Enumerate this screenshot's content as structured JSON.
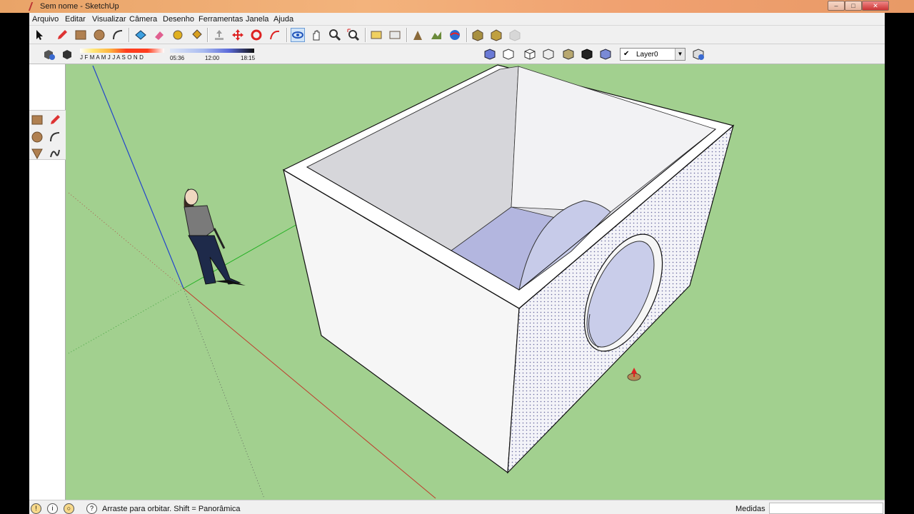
{
  "window": {
    "title": "Sem nome - SketchUp",
    "controls": {
      "minimize": "–",
      "maximize": "□",
      "close": "✕"
    }
  },
  "menu": [
    "Arquivo",
    "Editar",
    "Visualizar",
    "Câmera",
    "Desenho",
    "Ferramentas",
    "Janela",
    "Ajuda"
  ],
  "toolbar_main": [
    "select-icon",
    "pencil-icon",
    "rectangle-icon",
    "circle-icon",
    "arc-icon",
    "make-component-icon",
    "eraser-icon",
    "tape-measure-icon",
    "paint-bucket-icon",
    "push-pull-icon",
    "move-icon",
    "rotate-icon",
    "follow-me-icon",
    "orbit-icon",
    "pan-icon",
    "zoom-icon",
    "zoom-extents-icon",
    "previous-view-icon",
    "next-view-icon",
    "add-location-icon",
    "toggle-terrain-icon",
    "google-earth-icon",
    "get-models-icon",
    "share-model-icon",
    "share-component-icon"
  ],
  "shadows": {
    "months": "J F M A M J J A S O N D",
    "time_start": "05:36",
    "time_mid": "12:00",
    "time_end": "18:15"
  },
  "layer": {
    "name": "Layer0",
    "active_check": "✔"
  },
  "status": {
    "message": "Arraste para orbitar. Shift = Panorâmica",
    "measures_label": "Medidas",
    "measures_value": ""
  },
  "colors": {
    "ground": "#a2d08f",
    "box_face_light": "#f6f6f6",
    "box_face_back": "#e0e0e6",
    "inner_floor": "#b3b6df",
    "axis_red": "#c0392b",
    "axis_green": "#22b022",
    "axis_blue": "#2244cc"
  }
}
